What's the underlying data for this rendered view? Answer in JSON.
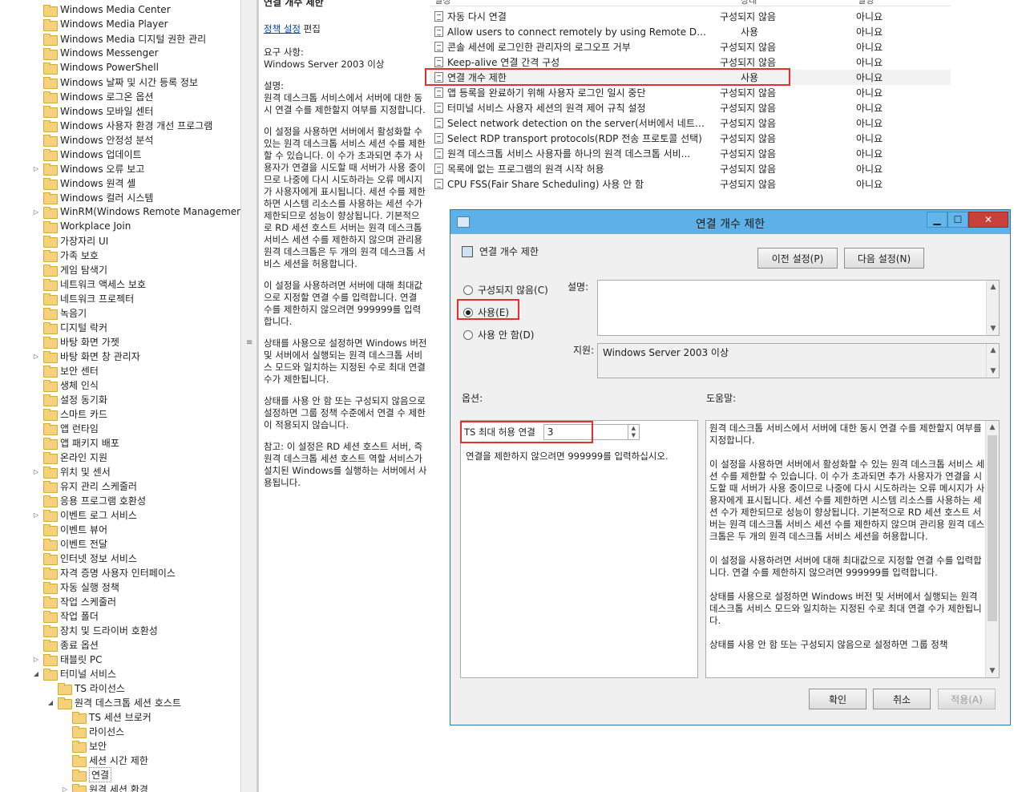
{
  "tree": {
    "items": [
      {
        "label": "Windows Media Center",
        "expandable": false
      },
      {
        "label": "Windows Media Player",
        "expandable": false
      },
      {
        "label": "Windows Media 디지털 권한 관리",
        "expandable": false
      },
      {
        "label": "Windows Messenger",
        "expandable": false
      },
      {
        "label": "Windows PowerShell",
        "expandable": false
      },
      {
        "label": "Windows 날짜 및 시간 등록 정보",
        "expandable": false
      },
      {
        "label": "Windows 로그온 옵션",
        "expandable": false
      },
      {
        "label": "Windows 모바일 센터",
        "expandable": false
      },
      {
        "label": "Windows 사용자 환경 개선 프로그램",
        "expandable": false
      },
      {
        "label": "Windows 안정성 분석",
        "expandable": false
      },
      {
        "label": "Windows 업데이트",
        "expandable": false
      },
      {
        "label": "Windows 오류 보고",
        "expandable": true
      },
      {
        "label": "Windows 원격 셸",
        "expandable": false
      },
      {
        "label": "Windows 컬러 시스템",
        "expandable": false
      },
      {
        "label": "WinRM(Windows Remote Management)",
        "expandable": true
      },
      {
        "label": "Workplace Join",
        "expandable": false
      },
      {
        "label": "가장자리 UI",
        "expandable": false
      },
      {
        "label": "가족 보호",
        "expandable": false
      },
      {
        "label": "게임 탐색기",
        "expandable": false
      },
      {
        "label": "네트워크 액세스 보호",
        "expandable": false
      },
      {
        "label": "네트워크 프로젝터",
        "expandable": false
      },
      {
        "label": "녹음기",
        "expandable": false
      },
      {
        "label": "디지털 락커",
        "expandable": false
      },
      {
        "label": "바탕 화면 가젯",
        "expandable": false
      },
      {
        "label": "바탕 화면 창 관리자",
        "expandable": true
      },
      {
        "label": "보안 센터",
        "expandable": false
      },
      {
        "label": "생체 인식",
        "expandable": false
      },
      {
        "label": "설정 동기화",
        "expandable": false
      },
      {
        "label": "스마트 카드",
        "expandable": false
      },
      {
        "label": "앱 런타임",
        "expandable": false
      },
      {
        "label": "앱 패키지 배포",
        "expandable": false
      },
      {
        "label": "온라인 지원",
        "expandable": false
      },
      {
        "label": "위치 및 센서",
        "expandable": true
      },
      {
        "label": "유지 관리 스케줄러",
        "expandable": false
      },
      {
        "label": "응용 프로그램 호환성",
        "expandable": false
      },
      {
        "label": "이벤트 로그 서비스",
        "expandable": true
      },
      {
        "label": "이벤트 뷰어",
        "expandable": false
      },
      {
        "label": "이벤트 전달",
        "expandable": false
      },
      {
        "label": "인터넷 정보 서비스",
        "expandable": false
      },
      {
        "label": "자격 증명 사용자 인터페이스",
        "expandable": false
      },
      {
        "label": "자동 실행 정책",
        "expandable": false
      },
      {
        "label": "작업 스케줄러",
        "expandable": false
      },
      {
        "label": "작업 폴더",
        "expandable": false
      },
      {
        "label": "장치 및 드라이버 호환성",
        "expandable": false
      },
      {
        "label": "종료 옵션",
        "expandable": false
      },
      {
        "label": "태블릿 PC",
        "expandable": true
      },
      {
        "label": "터미널 서비스",
        "expandable": true,
        "expanded": true
      },
      {
        "label": "TS 라이선스",
        "expandable": false,
        "indent": 1
      },
      {
        "label": "원격 데스크톱 세션 호스트",
        "expandable": true,
        "expanded": true,
        "indent": 1
      },
      {
        "label": "TS 세션 브로커",
        "expandable": false,
        "indent": 2
      },
      {
        "label": "라이선스",
        "expandable": false,
        "indent": 2
      },
      {
        "label": "보안",
        "expandable": false,
        "indent": 2
      },
      {
        "label": "세션 시간 제한",
        "expandable": false,
        "indent": 2
      },
      {
        "label": "연결",
        "expandable": false,
        "indent": 2,
        "selected": true
      },
      {
        "label": "원격 세션 환경",
        "expandable": true,
        "indent": 2
      }
    ]
  },
  "desc": {
    "title": "연결 개수 제한",
    "edit_link": "정책 설정",
    "edit_suffix": " 편집",
    "requirements": "요구 사항:\nWindows Server 2003 이상",
    "description": "설명:\n원격 데스크톱 서비스에서 서버에 대한 동시 연결 수를 제한할지 여부를 지정합니다.",
    "para1": "이 설정을 사용하면 서버에서 활성화할 수 있는 원격 데스크톱 서비스 세션 수를 제한할 수 있습니다. 이 수가 초과되면 추가 사용자가 연결을 시도할 때 서버가 사용 중이므로 나중에 다시 시도하라는 오류 메시지가 사용자에게 표시됩니다. 세션 수를 제한하면 시스템 리소스를 사용하는 세션 수가 제한되므로 성능이 향상됩니다. 기본적으로 RD 세션 호스트 서버는 원격 데스크톱 서비스 세션 수를 제한하지 않으며 관리용 원격 데스크톱은 두 개의 원격 데스크톱 서비스 세션을 허용합니다.",
    "para2": "이 설정을 사용하려면 서버에 대해 최대값으로 지정할 연결 수를 입력합니다. 연결 수를 제한하지 않으려면 999999를 입력합니다.",
    "para3": "상태를 사용으로 설정하면 Windows 버전 및 서버에서 실행되는 원격 데스크톱 서비스 모드와 일치하는 지정된 수로 최대 연결 수가 제한됩니다.",
    "para4": "상태를 사용 안 함 또는 구성되지 않음으로 설정하면 그룹 정책 수준에서 연결 수 제한이 적용되지 않습니다.",
    "para5": "참고: 이 설정은 RD 세션 호스트 서버, 즉 원격 데스크톱 세션 호스트 역할 서비스가 설치된 Windows를 실행하는 서버에서 사용됩니다."
  },
  "list": {
    "headers": {
      "setting": "설정",
      "state": "상태",
      "comment": "설명"
    },
    "rows": [
      {
        "name": "자동 다시 연결",
        "state": "구성되지 않음",
        "comment": "아니요"
      },
      {
        "name": "Allow users to connect remotely by using Remote Desktop...",
        "state": "사용",
        "comment": "아니요"
      },
      {
        "name": "콘솔 세션에 로그인한 관리자의 로그오프 거부",
        "state": "구성되지 않음",
        "comment": "아니요"
      },
      {
        "name": "Keep-alive 연결 간격 구성",
        "state": "구성되지 않음",
        "comment": "아니요"
      },
      {
        "name": "연결 개수 제한",
        "state": "사용",
        "comment": "아니요",
        "highlight": true
      },
      {
        "name": "앱 등록을 완료하기 위해 사용자 로그인 일시 중단",
        "state": "구성되지 않음",
        "comment": "아니요"
      },
      {
        "name": "터미널 서비스 사용자 세션의 원격 제어 규칙 설정",
        "state": "구성되지 않음",
        "comment": "아니요"
      },
      {
        "name": "Select network detection on the server(서버에서 네트워크 ...",
        "state": "구성되지 않음",
        "comment": "아니요"
      },
      {
        "name": "Select RDP transport protocols(RDP 전송 프로토콜 선택)",
        "state": "구성되지 않음",
        "comment": "아니요"
      },
      {
        "name": "원격 데스크톱 서비스 사용자를 하나의 원격 데스크톱 서비...",
        "state": "구성되지 않음",
        "comment": "아니요"
      },
      {
        "name": "목록에 없는 프로그램의 원격 시작 허용",
        "state": "구성되지 않음",
        "comment": "아니요"
      },
      {
        "name": "CPU FSS(Fair Share Scheduling) 사용 안 함",
        "state": "구성되지 않음",
        "comment": "아니요"
      }
    ]
  },
  "dialog": {
    "title": "연결 개수 제한",
    "setting_name": "연결 개수 제한",
    "prev_button": "이전 설정(P)",
    "next_button": "다음 설정(N)",
    "radio_not_configured": "구성되지 않음(C)",
    "radio_enabled": "사용(E)",
    "radio_disabled": "사용 안 함(D)",
    "selected_radio": "enabled",
    "comment_label": "설명:",
    "comment_value": "",
    "supported_label": "지원:",
    "supported_value": "Windows Server 2003 이상",
    "options_label": "옵션:",
    "help_label": "도움말:",
    "ts_max_label": "TS 최대 허용 연결",
    "ts_max_value": "3",
    "options_note": "연결을 제한하지 않으려면 999999를 입력하십시오.",
    "help_text": "원격 데스크톱 서비스에서 서버에 대한 동시 연결 수를 제한할지 여부를 지정합니다.\n\n이 설정을 사용하면 서버에서 활성화할 수 있는 원격 데스크톱 서비스 세션 수를 제한할 수 있습니다. 이 수가 초과되면 추가 사용자가 연결을 시도할 때 서버가 사용 중이므로 나중에 다시 시도하라는 오류 메시지가 사용자에게 표시됩니다. 세션 수를 제한하면 시스템 리소스를 사용하는 세션 수가 제한되므로 성능이 향상됩니다. 기본적으로 RD 세션 호스트 서버는 원격 데스크톱 서비스 세션 수를 제한하지 않으며 관리용 원격 데스크톱은 두 개의 원격 데스크톱 서비스 세션을 허용합니다.\n\n이 설정을 사용하려면 서버에 대해 최대값으로 지정할 연결 수를 입력합니다. 연결 수를 제한하지 않으려면 999999를 입력합니다.\n\n상태를 사용으로 설정하면 Windows 버전 및 서버에서 실행되는 원격 데스크톱 서비스 모드와 일치하는 지정된 수로 최대 연결 수가 제한됩니다.\n\n상태를 사용 안 함 또는 구성되지 않음으로 설정하면 그룹 정책",
    "ok_button": "확인",
    "cancel_button": "취소",
    "apply_button": "적용(A)"
  },
  "colors": {
    "titlebar": "#5cb2e8",
    "close_button": "#c7413a",
    "highlight_box": "#e03030",
    "folder": "#f3d27b",
    "link": "#0645ad"
  }
}
